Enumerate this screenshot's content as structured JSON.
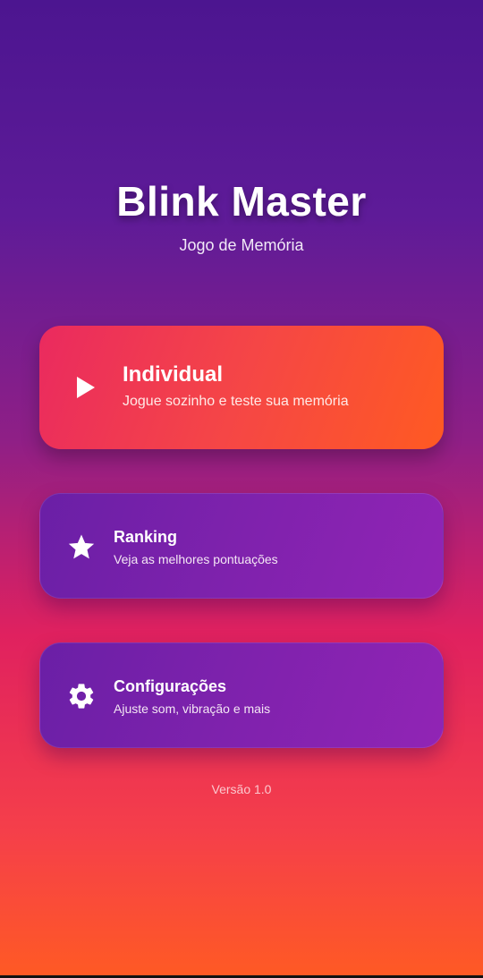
{
  "header": {
    "title": "Blink Master",
    "subtitle": "Jogo de Memória"
  },
  "menu": {
    "individual": {
      "title": "Individual",
      "description": "Jogue sozinho e teste sua memória",
      "icon": "play-icon"
    },
    "ranking": {
      "title": "Ranking",
      "description": "Veja as melhores pontuações",
      "icon": "star-icon"
    },
    "settings": {
      "title": "Configurações",
      "description": "Ajuste som, vibração e mais",
      "icon": "gear-icon"
    }
  },
  "footer": {
    "version": "Versão 1.0"
  },
  "colors": {
    "background_top": "#4c1590",
    "background_bottom": "#ff5a24",
    "primary_card_start": "#ea2a5f",
    "primary_card_end": "#ff5a22",
    "secondary_card": "#7f22ad",
    "text": "#ffffff"
  }
}
